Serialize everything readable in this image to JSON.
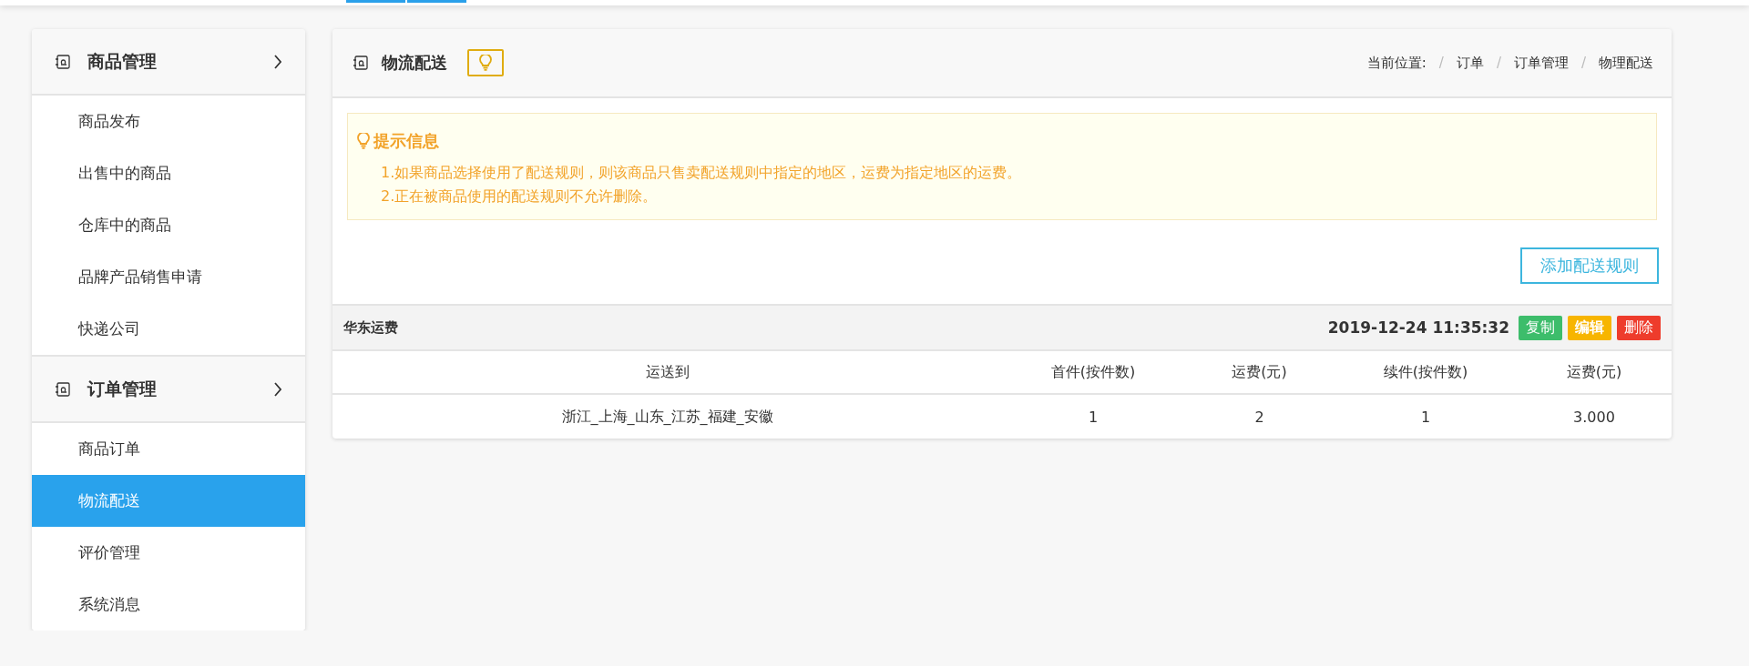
{
  "sidebar": {
    "sections": [
      {
        "title": "商品管理",
        "expanded": true,
        "items": [
          {
            "label": "商品发布",
            "selected": false
          },
          {
            "label": "出售中的商品",
            "selected": false
          },
          {
            "label": "仓库中的商品",
            "selected": false
          },
          {
            "label": "品牌产品销售申请",
            "selected": false
          },
          {
            "label": "快递公司",
            "selected": false
          }
        ]
      },
      {
        "title": "订单管理",
        "expanded": true,
        "items": [
          {
            "label": "商品订单",
            "selected": false
          },
          {
            "label": "物流配送",
            "selected": true
          },
          {
            "label": "评价管理",
            "selected": false
          },
          {
            "label": "系统消息",
            "selected": false
          }
        ]
      }
    ]
  },
  "page": {
    "title": "物流配送",
    "breadcrumb": {
      "label": "当前位置:",
      "separator": "/",
      "items": [
        "订单",
        "订单管理",
        "物理配送"
      ]
    }
  },
  "notice": {
    "title": "提示信息",
    "lines": [
      "1.如果商品选择使用了配送规则，则该商品只售卖配送规则中指定的地区，运费为指定地区的运费。",
      "2.正在被商品使用的配送规则不允许删除。"
    ]
  },
  "add_button": "添加配送规则",
  "rules": [
    {
      "name": "华东运费",
      "time": "2019-12-24 11:35:32",
      "actions": [
        {
          "label": "复制",
          "kind": "copy"
        },
        {
          "label": "编辑",
          "kind": "edit"
        },
        {
          "label": "删除",
          "kind": "delete"
        }
      ],
      "columns": [
        "运送到",
        "首件(按件数)",
        "运费(元)",
        "续件(按件数)",
        "运费(元)"
      ],
      "rows": [
        [
          "浙江_上海_山东_江苏_福建_安徽",
          "1",
          "2",
          "1",
          "3.000"
        ]
      ]
    }
  ]
}
